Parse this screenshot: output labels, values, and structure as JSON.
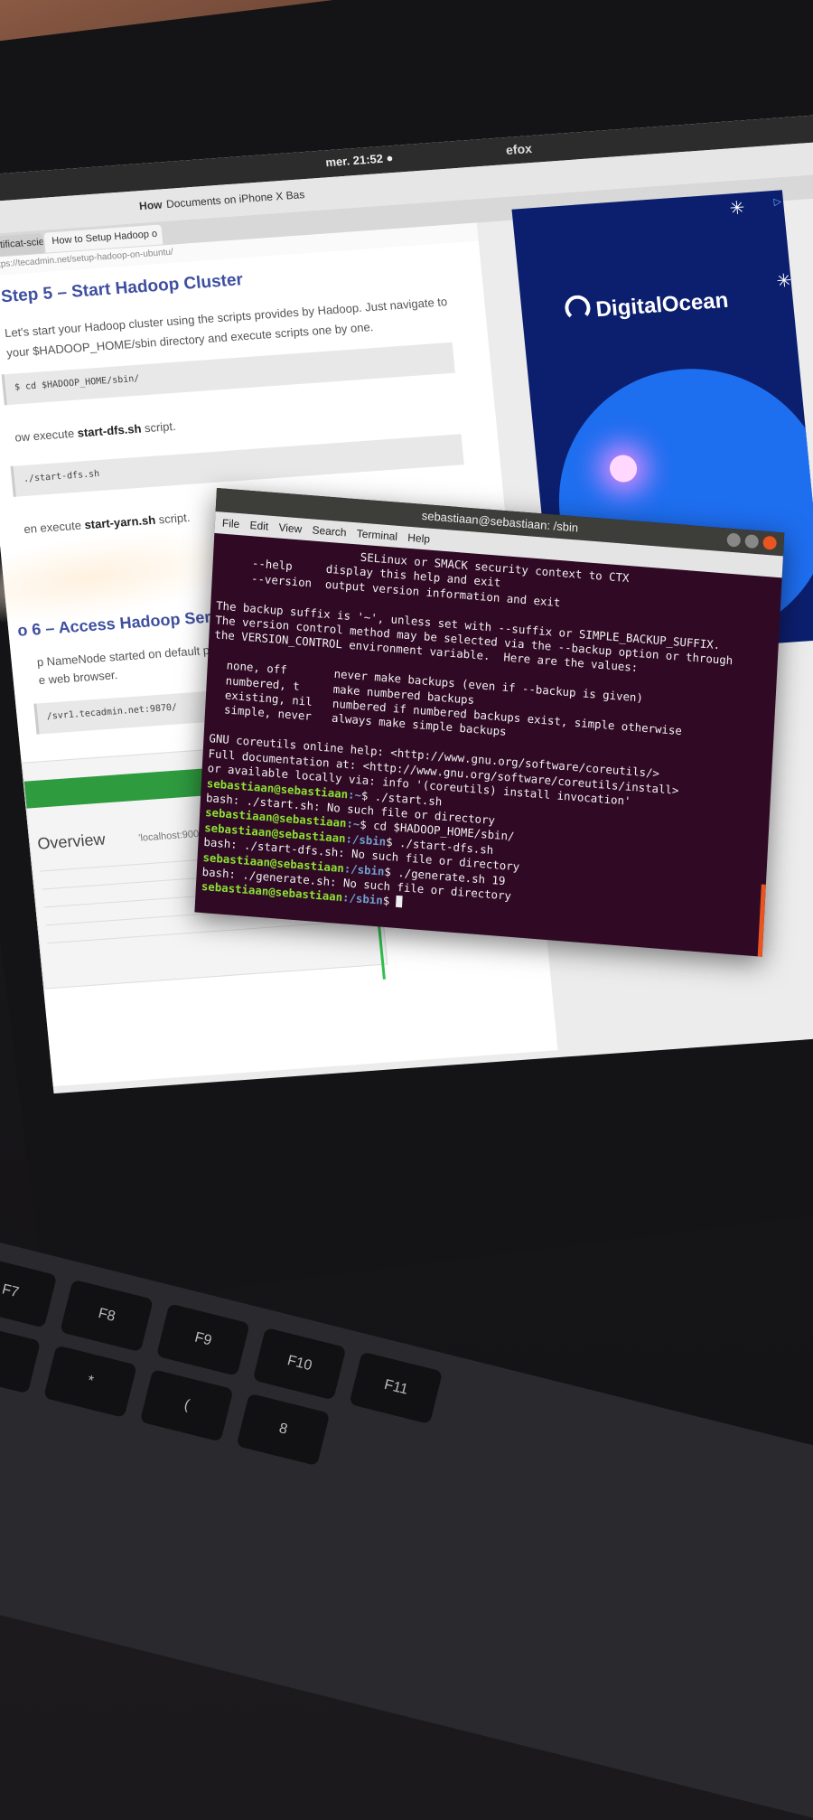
{
  "topbar": {
    "clock": "mer. 21:52 ●",
    "app": "efox"
  },
  "browser": {
    "title_left": "How",
    "title": "Documents on iPhone X Bas",
    "tabs": [
      "- Certificat-scien",
      "How to Setup Hadoop o"
    ],
    "url": "https://tecadmin.net/setup-hadoop-on-ubuntu/"
  },
  "article": {
    "heading": "Step 5 – Start Hadoop Cluster",
    "intro": "Let's start your Hadoop cluster using the scripts provides by Hadoop. Just navigate to your $HADOOP_HOME/sbin directory and execute scripts one by one.",
    "code1": "$ cd $HADOOP_HOME/sbin/",
    "line2_pre": "ow execute ",
    "line2_bold": "start-dfs.sh",
    "line2_post": " script.",
    "code2": "./start-dfs.sh",
    "line3_pre": "en execute ",
    "line3_bold": "start-yarn.sh",
    "line3_post": " script.",
    "heading2": "o 6 – Access Hadoop Services in",
    "p6a": "p NameNode started on default port 9870. Ac",
    "p6b": "e web browser.",
    "code3": "/svr1.tecadmin.net:9870/",
    "overview": "Overview",
    "overview_sub": "'localhost:9000' (active)"
  },
  "ad": {
    "brand": "DigitalOcean",
    "badge": "▷"
  },
  "terminal": {
    "title": "sebastiaan@sebastiaan: /sbin",
    "menu": [
      "File",
      "Edit",
      "View",
      "Search",
      "Terminal",
      "Help"
    ],
    "lines": [
      "                     SELinux or SMACK security context to CTX",
      "     --help     display this help and exit",
      "     --version  output version information and exit",
      "",
      "The backup suffix is '~', unless set with --suffix or SIMPLE_BACKUP_SUFFIX.",
      "The version control method may be selected via the --backup option or through",
      "the VERSION_CONTROL environment variable.  Here are the values:",
      "",
      "  none, off       never make backups (even if --backup is given)",
      "  numbered, t     make numbered backups",
      "  existing, nil   numbered if numbered backups exist, simple otherwise",
      "  simple, never   always make simple backups",
      "",
      "GNU coreutils online help: <http://www.gnu.org/software/coreutils/>",
      "Full documentation at: <http://www.gnu.org/software/coreutils/install>",
      "or available locally via: info '(coreutils) install invocation'"
    ],
    "prompt_user": "sebastiaan@sebastiaan",
    "session": [
      {
        "path": ":~",
        "cmd": "$ ./start.sh"
      },
      {
        "out": "bash: ./start.sh: No such file or directory"
      },
      {
        "path": ":~",
        "cmd": "$ cd $HADOOP_HOME/sbin/"
      },
      {
        "path": ":/sbin",
        "cmd": "$ ./start-dfs.sh"
      },
      {
        "out": "bash: ./start-dfs.sh: No such file or directory"
      },
      {
        "path": ":/sbin",
        "cmd": "$ ./generate.sh 19"
      },
      {
        "out": "bash: ./generate.sh: No such file or directory"
      },
      {
        "path": ":/sbin",
        "cmd": "$ "
      }
    ]
  },
  "keyboard": {
    "keys": [
      "F7",
      "F8",
      "F9",
      "F10",
      "F11",
      "&",
      "*",
      "(",
      "8"
    ]
  }
}
